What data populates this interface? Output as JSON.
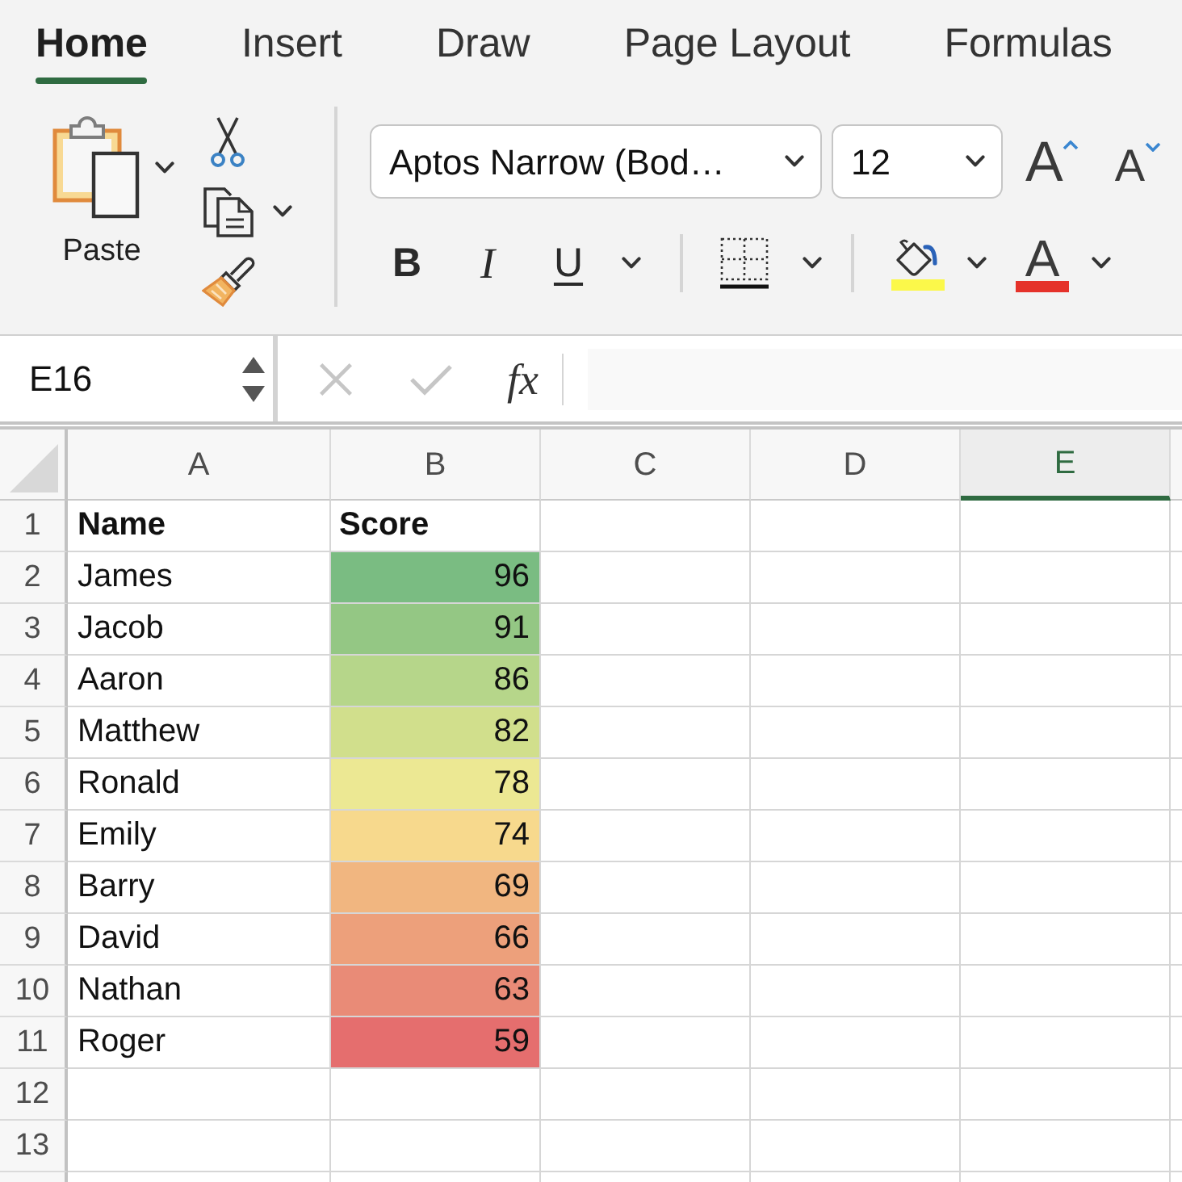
{
  "ribbon_tabs": [
    {
      "label": "Home",
      "selected": true
    },
    {
      "label": "Insert",
      "selected": false
    },
    {
      "label": "Draw",
      "selected": false
    },
    {
      "label": "Page Layout",
      "selected": false
    },
    {
      "label": "Formulas",
      "selected": false
    }
  ],
  "clipboard": {
    "paste_label": "Paste"
  },
  "font": {
    "name": "Aptos Narrow (Bod…",
    "size": "12"
  },
  "font_size_buttons": [
    {
      "kind": "grow",
      "label": "A"
    },
    {
      "kind": "shrink",
      "label": "A"
    }
  ],
  "format_buttons": [
    {
      "kind": "bold",
      "label": "B"
    },
    {
      "kind": "italic",
      "label": "I"
    },
    {
      "kind": "underline",
      "label": "U"
    }
  ],
  "color_buttons": [
    {
      "kind": "fill",
      "color": "#fbf84a"
    },
    {
      "kind": "font",
      "label": "A",
      "color": "#e5322a"
    }
  ],
  "name_box": {
    "value": "E16"
  },
  "formula_bar": {
    "editing": false,
    "function_label": "fx"
  },
  "columns": [
    {
      "label": "A",
      "selected": false
    },
    {
      "label": "B",
      "selected": false
    },
    {
      "label": "C",
      "selected": false
    },
    {
      "label": "D",
      "selected": false
    },
    {
      "label": "E",
      "selected": true
    }
  ],
  "rows": [
    {
      "number": "1",
      "kind": "header",
      "name": "Name",
      "score": "Score"
    },
    {
      "number": "2",
      "kind": "data",
      "name": "James",
      "score": "96",
      "color": "#7abc82"
    },
    {
      "number": "3",
      "kind": "data",
      "name": "Jacob",
      "score": "91",
      "color": "#94c784"
    },
    {
      "number": "4",
      "kind": "data",
      "name": "Aaron",
      "score": "86",
      "color": "#b6d68a"
    },
    {
      "number": "5",
      "kind": "data",
      "name": "Matthew",
      "score": "82",
      "color": "#d1df8c"
    },
    {
      "number": "6",
      "kind": "data",
      "name": "Ronald",
      "score": "78",
      "color": "#ece893"
    },
    {
      "number": "7",
      "kind": "data",
      "name": "Emily",
      "score": "74",
      "color": "#f7d98d"
    },
    {
      "number": "8",
      "kind": "data",
      "name": "Barry",
      "score": "69",
      "color": "#f1b680"
    },
    {
      "number": "9",
      "kind": "data",
      "name": "David",
      "score": "66",
      "color": "#eda07b"
    },
    {
      "number": "10",
      "kind": "data",
      "name": "Nathan",
      "score": "63",
      "color": "#e98b77"
    },
    {
      "number": "11",
      "kind": "data",
      "name": "Roger",
      "score": "59",
      "color": "#e56e6e"
    },
    {
      "number": "12",
      "kind": "empty"
    },
    {
      "number": "13",
      "kind": "empty"
    }
  ]
}
